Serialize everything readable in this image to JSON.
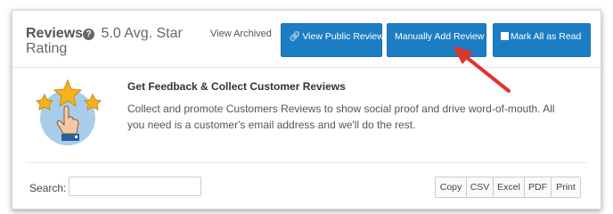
{
  "header": {
    "title_bold": "Reviews",
    "title_rest": "5.0 Avg. Star Rating",
    "view_archived": "View Archived",
    "buttons": {
      "view_public": "View Public Reviews",
      "manually_add": "Manually Add Review",
      "mark_all_read": "Mark All as Read"
    }
  },
  "feedback": {
    "title": "Get Feedback & Collect Customer Reviews",
    "body": "Collect and promote Customers Reviews to show social proof and drive word-of-mouth. All you need is a customer's email address and we'll do the rest."
  },
  "table_controls": {
    "search_label": "Search:",
    "search_value": "",
    "export_buttons": [
      "Copy",
      "CSV",
      "Excel",
      "PDF",
      "Print"
    ]
  },
  "colors": {
    "primary_button": "#1d7dc4",
    "annotation_arrow": "#e0332e",
    "star": "#f6b21e",
    "illustration_bg": "#a8cdea"
  },
  "icons": {
    "help": "question-circle-icon",
    "view_public": "share-icon",
    "mark_all_read": "inbox-icon",
    "illustration": "hand-selecting-stars-icon",
    "annotation": "red-arrow"
  }
}
